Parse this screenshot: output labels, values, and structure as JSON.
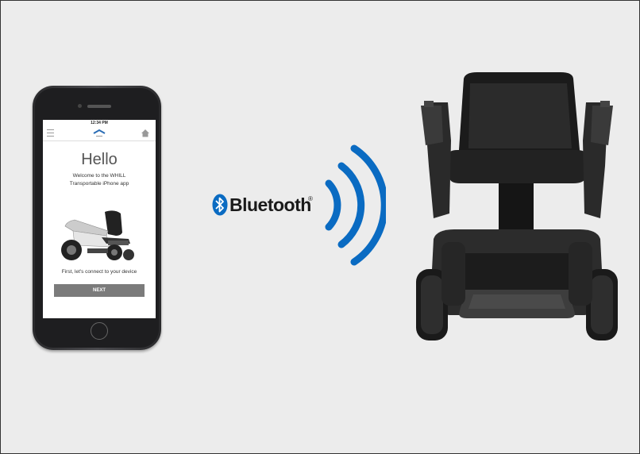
{
  "phone": {
    "status_time": "12:34 PM",
    "screen": {
      "title": "Hello",
      "welcome_line1": "Welcome to the WHILL",
      "welcome_line2": "Transportable iPhone app",
      "connect_text": "First, let's connect to your device",
      "next_button": "NEXT"
    }
  },
  "bluetooth": {
    "label": "Bluetooth",
    "trademark": "®",
    "brand_color": "#0a6bc2"
  },
  "icons": [
    "menu-icon",
    "whill-logo-icon",
    "home-icon",
    "bluetooth-icon",
    "signal-waves-icon"
  ]
}
